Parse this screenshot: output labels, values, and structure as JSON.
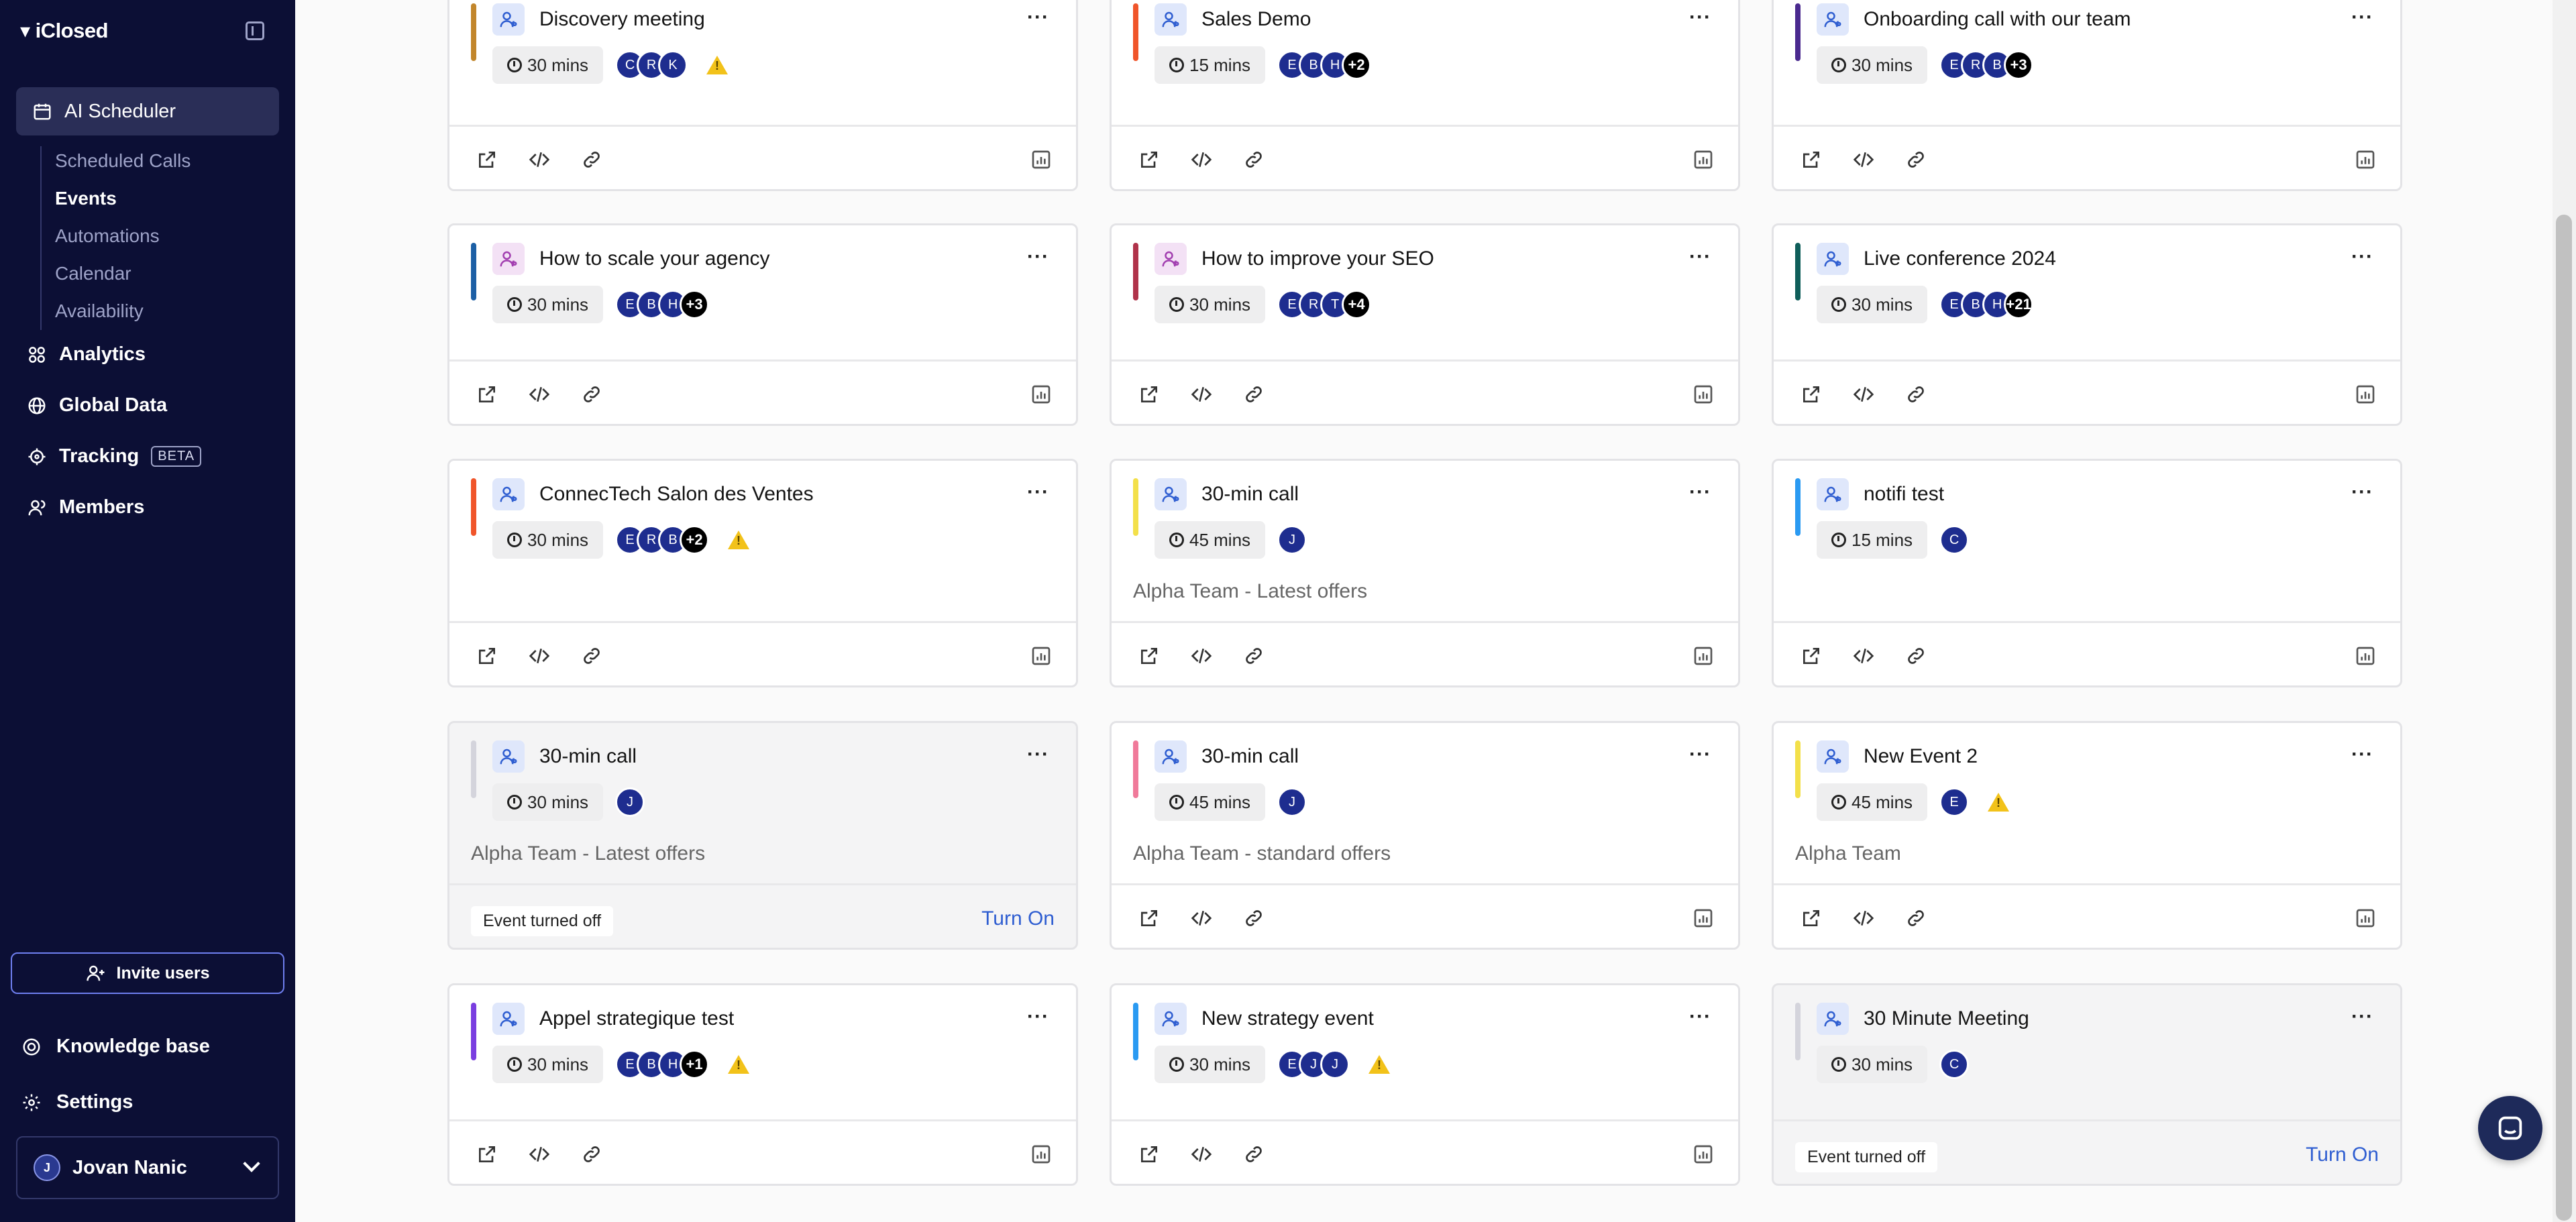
{
  "app": {
    "brand": "iClosed"
  },
  "sidebar": {
    "active_item": "AI Scheduler",
    "sub_items": [
      "Scheduled Calls",
      "Events",
      "Automations",
      "Calendar",
      "Availability"
    ],
    "items": [
      "Analytics",
      "Global Data",
      "Tracking",
      "Members"
    ],
    "beta_badge": "BETA",
    "invite_label": "Invite users",
    "knowledge_base": "Knowledge base",
    "settings": "Settings",
    "user": {
      "initial": "J",
      "name": "Jovan Nanic"
    }
  },
  "cards": [
    {
      "title": "Discovery meeting",
      "duration": "30 mins",
      "avatars": [
        "C",
        "R",
        "K"
      ],
      "more": "",
      "warning": true,
      "stripe": "#c2862b",
      "icon": "purple-false",
      "subtitle": "",
      "off": false
    },
    {
      "title": "Sales Demo",
      "duration": "15 mins",
      "avatars": [
        "E",
        "B",
        "H"
      ],
      "more": "+2",
      "warning": false,
      "stripe": "#f0552a",
      "subtitle": "",
      "off": false
    },
    {
      "title": "Onboarding call with our team",
      "duration": "30 mins",
      "avatars": [
        "E",
        "R",
        "B"
      ],
      "more": "+3",
      "warning": false,
      "stripe": "#4a2a8f",
      "subtitle": "",
      "off": false
    },
    {
      "title": "How to scale your agency",
      "duration": "30 mins",
      "avatars": [
        "E",
        "B",
        "H"
      ],
      "more": "+3",
      "warning": false,
      "stripe": "#1c5fa5",
      "subtitle": "",
      "off": false
    },
    {
      "title": "How to improve your SEO",
      "duration": "30 mins",
      "avatars": [
        "E",
        "R",
        "T"
      ],
      "more": "+4",
      "warning": false,
      "stripe": "#b0334a",
      "subtitle": "",
      "off": false
    },
    {
      "title": "Live conference 2024",
      "duration": "30 mins",
      "avatars": [
        "E",
        "B",
        "H"
      ],
      "more": "+21",
      "warning": false,
      "stripe": "#0f5e5a",
      "subtitle": "",
      "off": false
    },
    {
      "title": "ConnecTech Salon des Ventes",
      "duration": "30 mins",
      "avatars": [
        "E",
        "R",
        "B"
      ],
      "more": "+2",
      "warning": true,
      "stripe": "#f0552a",
      "subtitle": "",
      "off": false
    },
    {
      "title": "30-min call",
      "duration": "45 mins",
      "avatars": [
        "J"
      ],
      "more": "",
      "warning": false,
      "stripe": "#f3e04a",
      "subtitle": "Alpha Team - Latest offers",
      "off": false
    },
    {
      "title": "notifi test",
      "duration": "15 mins",
      "avatars": [
        "C"
      ],
      "more": "",
      "warning": false,
      "stripe": "#2a9af2",
      "subtitle": "",
      "off": false
    },
    {
      "title": "30-min call",
      "duration": "30 mins",
      "avatars": [
        "J"
      ],
      "more": "",
      "warning": false,
      "stripe": "#d4d4dc",
      "subtitle": "Alpha Team - Latest offers",
      "off": true
    },
    {
      "title": "30-min call",
      "duration": "45 mins",
      "avatars": [
        "J"
      ],
      "more": "",
      "warning": false,
      "stripe": "#f07a9a",
      "subtitle": "Alpha Team - standard offers",
      "off": false
    },
    {
      "title": "New Event 2",
      "duration": "45 mins",
      "avatars": [
        "E"
      ],
      "more": "",
      "warning": true,
      "stripe": "#f3e04a",
      "subtitle": "Alpha Team",
      "off": false
    },
    {
      "title": "Appel strategique test",
      "duration": "30 mins",
      "avatars": [
        "E",
        "B",
        "H"
      ],
      "more": "+1",
      "warning": true,
      "stripe": "#7a3ee0",
      "subtitle": "",
      "off": false
    },
    {
      "title": "New strategy event",
      "duration": "30 mins",
      "avatars": [
        "E",
        "J",
        "J"
      ],
      "more": "",
      "warning": true,
      "stripe": "#2a9af2",
      "subtitle": "",
      "off": false
    },
    {
      "title": "30 Minute Meeting",
      "duration": "30 mins",
      "avatars": [
        "C"
      ],
      "more": "",
      "warning": false,
      "stripe": "#d4d4dc",
      "subtitle": "",
      "off": true
    }
  ],
  "card_labels": {
    "event_off": "Event turned off",
    "turn_on": "Turn On",
    "more_menu": "···"
  },
  "colors": {
    "sidebar_bg": "#0c0f35",
    "accent": "#2f5ed1",
    "avatar": "#1e2d8f",
    "warning": "#f2c21a"
  }
}
